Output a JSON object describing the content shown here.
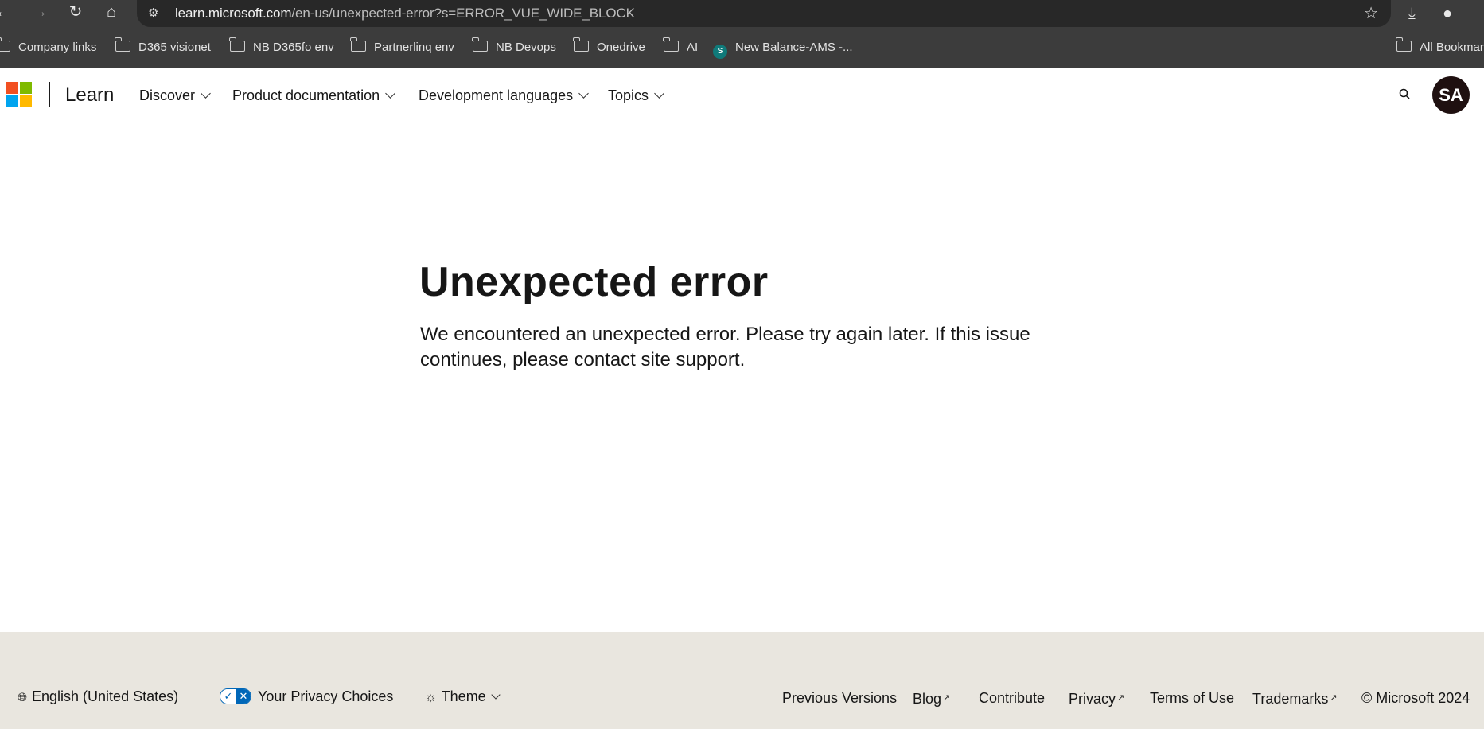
{
  "browser": {
    "url_host": "learn.microsoft.com",
    "url_path": "/en-us/unexpected-error?s=ERROR_VUE_WIDE_BLOCK",
    "bookmarks": [
      {
        "label": "Company links",
        "icon": "folder-icon"
      },
      {
        "label": "D365 visionet",
        "icon": "folder-icon"
      },
      {
        "label": "NB D365fo env",
        "icon": "folder-icon"
      },
      {
        "label": "Partnerlinq env",
        "icon": "folder-icon"
      },
      {
        "label": "NB Devops",
        "icon": "folder-icon"
      },
      {
        "label": "Onedrive",
        "icon": "folder-icon"
      },
      {
        "label": "AI",
        "icon": "folder-icon"
      },
      {
        "label": "New Balance-AMS -...",
        "icon": "sharepoint-icon"
      }
    ],
    "all_bookmarks": "All Bookmarks"
  },
  "header": {
    "brand": "Learn",
    "nav": [
      {
        "label": "Discover"
      },
      {
        "label": "Product documentation"
      },
      {
        "label": "Development languages"
      },
      {
        "label": "Topics"
      }
    ],
    "avatar_initials": "SA",
    "logo_colors": [
      "#f25022",
      "#7fba00",
      "#00a4ef",
      "#ffb900"
    ]
  },
  "main": {
    "title": "Unexpected error",
    "message": "We encountered an unexpected error. Please try again later. If this issue continues, please contact site support."
  },
  "footer": {
    "locale": "English (United States)",
    "privacy_choices": "Your Privacy Choices",
    "theme": "Theme",
    "links": {
      "previous_versions": "Previous Versions",
      "blog": "Blog",
      "contribute": "Contribute",
      "privacy": "Privacy",
      "terms": "Terms of Use",
      "trademarks": "Trademarks",
      "copyright": "© Microsoft 2024"
    }
  }
}
